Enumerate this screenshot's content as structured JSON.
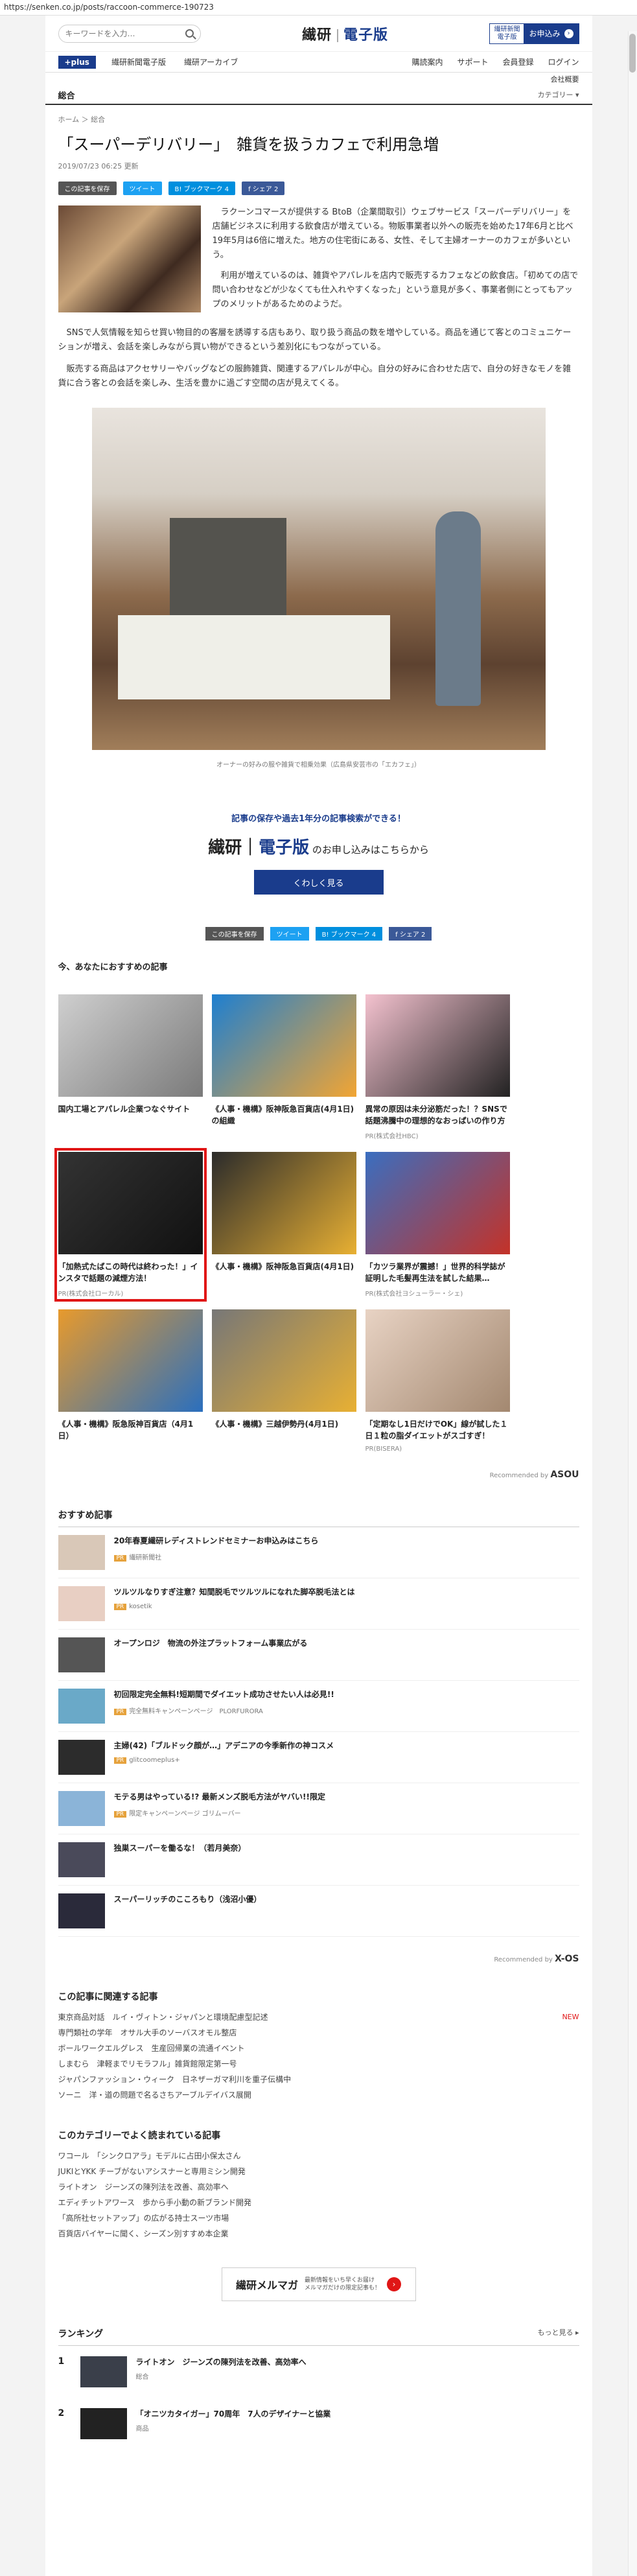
{
  "browser": {
    "url": "https://senken.co.jp/posts/raccoon-commerce-190723"
  },
  "header": {
    "search_placeholder": "キーワードを入力…",
    "logo_part1": "繊研",
    "logo_part2": "電子版",
    "edition_line1": "繊研新聞",
    "edition_line2": "電子版",
    "subscribe_label": "お申込み"
  },
  "nav": {
    "plus_label": "+plus",
    "items": [
      "繊研新聞電子版",
      "繊研アーカイブ"
    ],
    "right_items": [
      "購読案内",
      "サポート",
      "会員登録",
      "ログイン"
    ],
    "right_sub": "会社概要"
  },
  "section": {
    "name": "総合",
    "category_label": "カテゴリー ▾"
  },
  "breadcrumb": "ホーム ＞ 総合",
  "article": {
    "title": "「スーパーデリバリー」　雑貨を扱うカフェで利用急増",
    "date": "2019/07/23 06:25 更新",
    "share": {
      "save": "この記事を保存",
      "tweet": "ツイート",
      "hatena": "B! ブックマーク 4",
      "facebook": "f シェア 2"
    },
    "p1": "ラクーンコマースが提供する BtoB（企業間取引）ウェブサービス「スーパーデリバリー」を店舗ビジネスに利用する飲食店が増えている。物販事業者以外への販売を始めた17年6月と比べ19年5月は6倍に増えた。地方の住宅街にある、女性、そして主婦オーナーのカフェが多いという。",
    "p2": "利用が増えているのは、雑貨やアパレルを店内で販売するカフェなどの飲食店。「初めての店で問い合わせなどが少なくても仕入れやすくなった」という意見が多く、事業者側にとってもアップのメリットがあるためのようだ。",
    "p3": "SNSで人気情報を知らせ買い物目的の客層を誘導する店もあり、取り扱う商品の数を増やしている。商品を通じて客とのコミュニケーションが増え、会話を楽しみながら買い物ができるという差別化にもつながっている。",
    "p4": "販売する商品はアクセサリーやバッグなどの服飾雑貨、関連するアパレルが中心。自分の好みに合わせた店で、自分の好きなモノを雑貨に合う客との会話を楽しみ、生活を豊かに過ごす空間の店が見えてくる。",
    "photo_caption": "オーナーの好みの服や雑貨で相乗効果（広島県安芸市の「エカフェ」）"
  },
  "promo": {
    "line1": "記事の保存や過去1年分の記事検索ができる！",
    "logo1": "繊研",
    "logo2": "電子版",
    "line2": "のお申し込みはこちらから",
    "button": "くわしく見る"
  },
  "recommend": {
    "heading": "今、あなたにおすすめの記事",
    "cards": [
      {
        "caption": "国内工場とアパレル企業つなぐサイト",
        "pr": "",
        "colors": [
          "#cfcfcf",
          "#7a7a7a"
        ]
      },
      {
        "caption": "《人事・機構》阪神阪急百貨店(4月1日)の組織",
        "pr": "",
        "colors": [
          "#1e7fd0",
          "#f2a533"
        ]
      },
      {
        "caption": "異常の原因は未分泌筋だった！？SNSで話題沸騰中の理想的なおっぱいの作り方",
        "pr": "PR(株式会社HBC)",
        "colors": [
          "#f4c2cf",
          "#222222"
        ]
      },
      {
        "caption": "「加熱式たばこの時代は終わった！」インスタで話題の減煙方法！",
        "pr": "PR(株式会社ローカル)",
        "colors": [
          "#333333",
          "#111111"
        ]
      },
      {
        "caption": "《人事・機構》阪神阪急百貨店(4月1日)",
        "pr": "",
        "colors": [
          "#2b2b2b",
          "#e8b033"
        ]
      },
      {
        "caption": "「カツラ業界が震撼！」世界的科学誌が証明した毛髪再生法を試した結果…",
        "pr": "PR(株式会社ヨシューラー・シェ)",
        "colors": [
          "#3a6ec0",
          "#c43228"
        ]
      },
      {
        "caption": "《人事・機構》阪急阪神百貨店（4月1日）",
        "pr": "",
        "colors": [
          "#e89a2c",
          "#2a6fbe"
        ]
      },
      {
        "caption": "《人事・機構》三越伊勢丹(4月1日)",
        "pr": "",
        "colors": [
          "#777777",
          "#e8b033"
        ]
      },
      {
        "caption": "「定期なし1日だけでOK」線が試した１日１粒の脂ダイエットがスゴすぎ！",
        "pr": "PR(BISERA)",
        "colors": [
          "#e8d3c4",
          "#a38870"
        ]
      }
    ],
    "recommended_by": "Recommended by",
    "vendor": "ASOU"
  },
  "osusume": {
    "heading": "おすすめ記事",
    "items": [
      {
        "title": "20年春夏繊研レディストレンドセミナーお申込みはこちら",
        "source": "繊研新聞社",
        "color": "#d9c8b8"
      },
      {
        "title": "ツルツルなりすぎ注意？知間脱毛でツルツルになれた脚卒脱毛法とは",
        "source": "kosetik",
        "color": "#e8cfc3"
      },
      {
        "title": "オープンロジ　物流の外注プラットフォーム事業広がる",
        "source": "",
        "color": "#555555"
      },
      {
        "title": "初回限定完全無料!短期間でダイエット成功させたい人は必見!!",
        "source": "完全無料キャンペーンページ　PLORFURORA",
        "color": "#6aa9c8"
      },
      {
        "title": "主婦(42)「ブルドック顔が…」アデニアの今季新作の神コスメ",
        "source": "glitcoomeplus+",
        "color": "#2c2c2c"
      },
      {
        "title": "モテる男はやっている!? 最新メンズ脱毛方法がヤバい!!限定",
        "source": "限定キャンペーンページ ゴリムーバー",
        "color": "#8bb4d8"
      },
      {
        "title": "独巣スーパーを働るな！（若月美奈）",
        "source": "",
        "color": "#4a4a5a"
      },
      {
        "title": "スーパーリッチのこころもり（浅沼小優）",
        "source": "",
        "color": "#2a2a3a"
      }
    ],
    "recommended_by": "Recommended by",
    "vendor": "X-OS"
  },
  "related": {
    "heading": "この記事に関連する記事",
    "items": [
      "東京商品対話　ルイ・ヴィトン・ジャパンと環境配慮型記述",
      "専門類社の学年　オサル大手のソーバスオモル整店",
      "ボールワークエルグレス　生産回帰業の流通イベント",
      "しまむら　津軽までリモラフル」雑貨館限定第一号",
      "ジャパンファッション・ウィーク　日ネザーガマ利川を重子伝構中",
      "ソーニ　洋・道の問題で名るさちアーブルデイバス展開"
    ],
    "new_label": "NEW"
  },
  "category_ranking": {
    "heading": "このカテゴリーでよく読まれている記事",
    "items": [
      "ワコール　「シンクロアラ」モデルに占田小保太さん",
      "JUKIとYKK チーブがないアシスナーと専用ミシン開発",
      "ライトオン　ジーンズの陳列法を改善、高効率へ",
      "エディチットアワース　歩から手小動の新ブランド開発",
      "「高所社セットアップ」の広がる持士スーツ市場",
      "百貨店バイヤーに聞く、シーズン別すすめ本企業"
    ]
  },
  "merumaga": {
    "title": "繊研メルマガ",
    "sub1": "最新情報をいち早くお届け",
    "sub2": "メルマガだけの限定記事も！"
  },
  "ranking": {
    "heading": "ランキング",
    "more": "もっと見る ▸",
    "items": [
      {
        "num": "1",
        "title": "ライトオン　ジーンズの陳列法を改善、高効率へ",
        "source": "総合",
        "color": "#3a3f4a"
      },
      {
        "num": "2",
        "title": "「オニツカタイガー」70周年　7人のデザイナーと協業",
        "source": "商品",
        "color": "#222222"
      }
    ]
  }
}
